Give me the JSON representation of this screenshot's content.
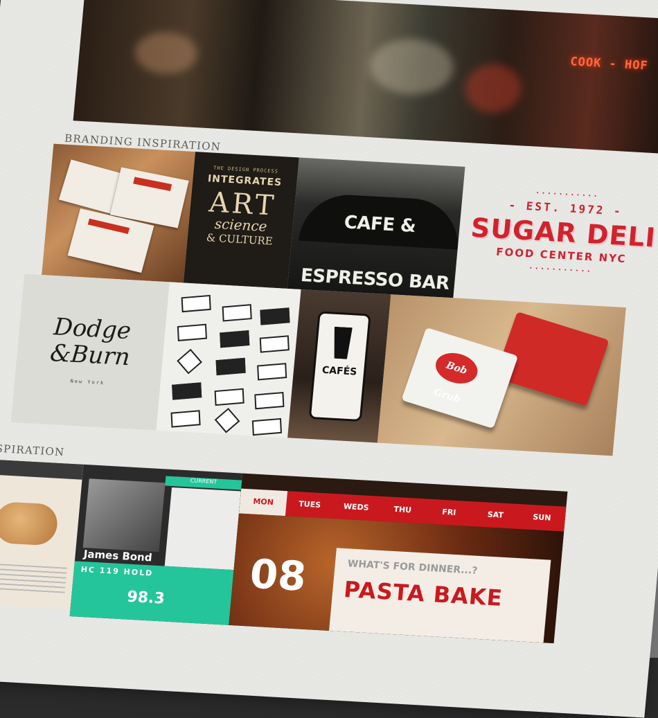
{
  "sections": {
    "branding_label": "BRANDING INSPIRATION",
    "web_label": "INSPIRATION"
  },
  "hero": {
    "sign_text": "COOK - HOF"
  },
  "branding": {
    "art_poster": {
      "line1": "THE DESIGN PROCESS",
      "line2": "INTEGRATES",
      "line3": "ART",
      "line4": "science",
      "line5": "& CULTURE"
    },
    "espresso_sign": "CAFE & ESPRESSO BAR",
    "sugar_deli": {
      "est": "- EST. 1972 -",
      "name": "SUGAR DELI",
      "sub": "FOOD CENTER NYC"
    },
    "dodge_burn": {
      "line1": "Dodge",
      "line2": "&Burn",
      "location": "New York"
    },
    "cafes_sign": "CAFÉS",
    "card_logo": "Bob Grub"
  },
  "web": {
    "bond": {
      "tab": "CURRENT",
      "name": "James Bond",
      "stats": "HC   119   HOLD",
      "score": "98.3"
    },
    "dinner": {
      "days": [
        "MON",
        "TUES",
        "WEDS",
        "THU",
        "FRI",
        "SAT",
        "SUN"
      ],
      "active_day": "MON",
      "date": "08",
      "question": "WHAT'S FOR DINNER...?",
      "dish": "PASTA BAKE"
    }
  },
  "colors": {
    "page_bg": "#e9e9e6",
    "brand_red": "#d0232d",
    "teal": "#25c59b"
  }
}
